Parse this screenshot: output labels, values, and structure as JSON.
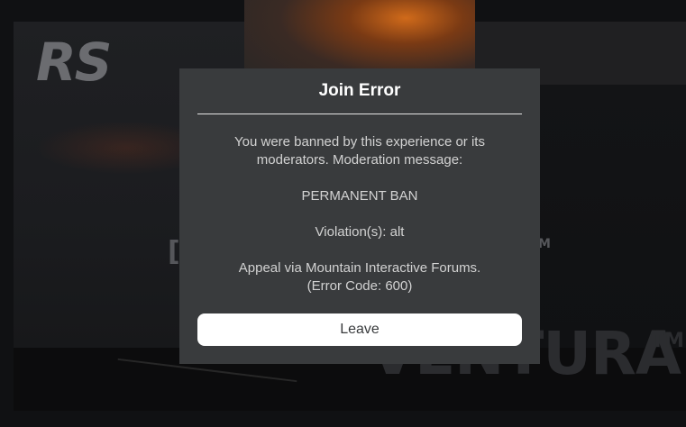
{
  "background": {
    "logo_text": "RS",
    "bracket_glyph": "[",
    "partial_text": "M",
    "watermark_text": "VENTURA",
    "trademark": "TM"
  },
  "dialog": {
    "title": "Join Error",
    "message_line_1": "You were banned by this experience or its moderators. Moderation message:",
    "message_line_2": "PERMANENT BAN",
    "message_line_3": "Violation(s): alt",
    "message_line_4": "Appeal via Mountain Interactive Forums.",
    "error_code": "(Error Code: 600)",
    "leave_label": "Leave"
  },
  "colors": {
    "dialog_background": "#393b3d",
    "title_text": "#ffffff",
    "body_text": "#d2d2d2",
    "button_background": "#ffffff",
    "button_text": "#393b3d"
  }
}
